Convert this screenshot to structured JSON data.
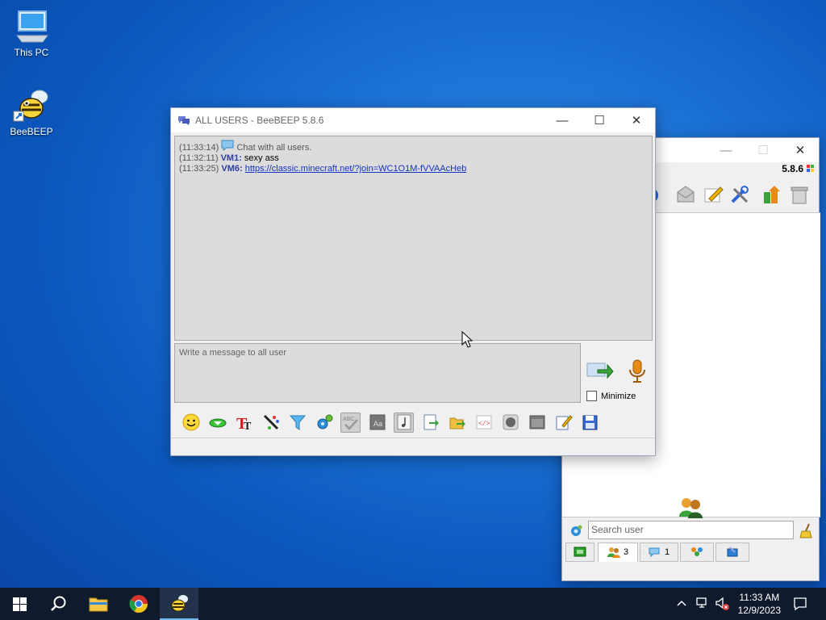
{
  "desktop": {
    "icons": [
      {
        "label": "This PC"
      },
      {
        "label": "BeeBEEP"
      }
    ]
  },
  "chat_window": {
    "title": "ALL USERS - BeeBEEP 5.8.6",
    "messages": [
      {
        "time": "(11:33:14)",
        "user": "",
        "text": "Chat with all users."
      },
      {
        "time": "(11:32:11)",
        "user": "VM1:",
        "text": "sexy ass"
      },
      {
        "time": "(11:33:25)",
        "user": "VM6:",
        "text": "https://classic.minecraft.net/?join=WC1O1M-fVVAAcHeb"
      }
    ],
    "input_placeholder": "Write a message to all user",
    "minimize_label": "Minimize",
    "minimize_checked": false,
    "toolbar_icons": [
      "emoticon-icon",
      "download-arrow-icon",
      "font-icon",
      "color-picker-icon",
      "filter-icon",
      "settings-gears-icon",
      "spellcheck-icon",
      "font-size-icon",
      "music-note-icon",
      "send-file-icon",
      "share-folder-icon",
      "html-code-icon",
      "record-icon",
      "screenshot-icon",
      "edit-note-icon",
      "save-chat-icon"
    ]
  },
  "main_window": {
    "version": "5.8.6",
    "search_placeholder": "Search user",
    "tabs": [
      {
        "icon": "users-icon",
        "count": "3"
      },
      {
        "icon": "chat-icon",
        "count": "1"
      }
    ]
  },
  "taskbar": {
    "time": "11:33 AM",
    "date": "12/9/2023"
  },
  "colors": {
    "desktop": "#1a6fd3",
    "taskbar": "#0f1b2d",
    "nick": "#2b3fa6",
    "link": "#1533c4"
  }
}
